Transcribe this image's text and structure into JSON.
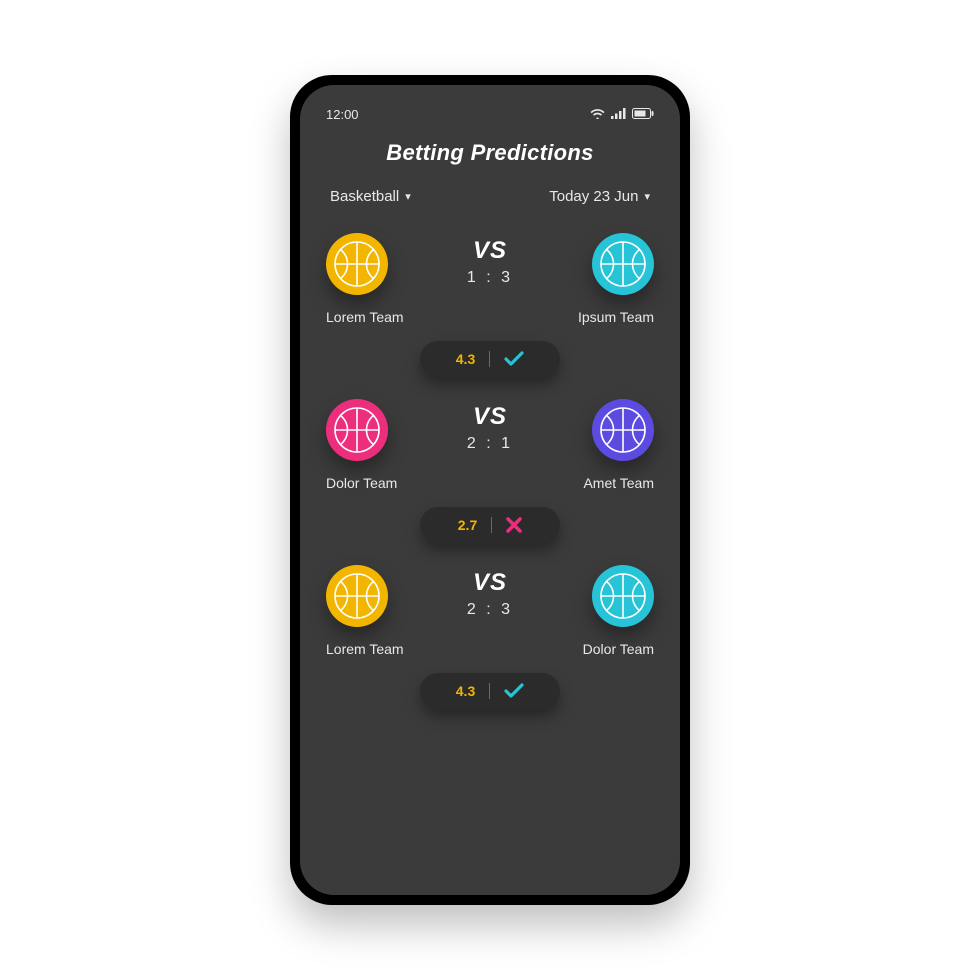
{
  "status": {
    "time": "12:00"
  },
  "title": "Betting Predictions",
  "filters": {
    "sport": "Basketball",
    "date": "Today 23 Jun"
  },
  "vs_label": "VS",
  "colors": {
    "yellow": "#f2b500",
    "cyan": "#26c4d6",
    "pink": "#ed2e7c",
    "purple": "#5b4be0"
  },
  "matches": [
    {
      "team_a": {
        "name": "Lorem Team",
        "color": "yellow"
      },
      "team_b": {
        "name": "Ipsum Team",
        "color": "cyan"
      },
      "score": "1 : 3",
      "odds": "4.3",
      "result": "win"
    },
    {
      "team_a": {
        "name": "Dolor Team",
        "color": "pink"
      },
      "team_b": {
        "name": "Amet Team",
        "color": "purple"
      },
      "score": "2 : 1",
      "odds": "2.7",
      "result": "loss"
    },
    {
      "team_a": {
        "name": "Lorem Team",
        "color": "yellow"
      },
      "team_b": {
        "name": "Dolor Team",
        "color": "cyan"
      },
      "score": "2 : 3",
      "odds": "4.3",
      "result": "win"
    }
  ]
}
